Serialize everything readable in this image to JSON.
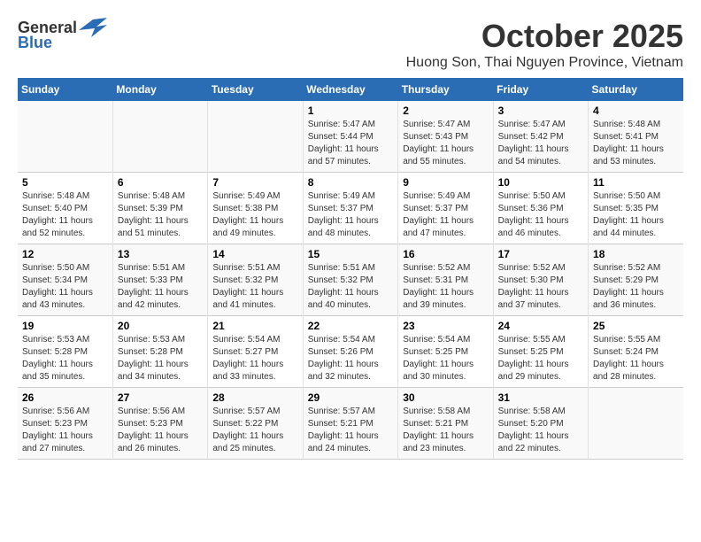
{
  "logo": {
    "general": "General",
    "blue": "Blue"
  },
  "title": {
    "month_year": "October 2025",
    "location": "Huong Son, Thai Nguyen Province, Vietnam"
  },
  "weekdays": [
    "Sunday",
    "Monday",
    "Tuesday",
    "Wednesday",
    "Thursday",
    "Friday",
    "Saturday"
  ],
  "weeks": [
    [
      {
        "day": "",
        "info": ""
      },
      {
        "day": "",
        "info": ""
      },
      {
        "day": "",
        "info": ""
      },
      {
        "day": "1",
        "info": "Sunrise: 5:47 AM\nSunset: 5:44 PM\nDaylight: 11 hours and 57 minutes."
      },
      {
        "day": "2",
        "info": "Sunrise: 5:47 AM\nSunset: 5:43 PM\nDaylight: 11 hours and 55 minutes."
      },
      {
        "day": "3",
        "info": "Sunrise: 5:47 AM\nSunset: 5:42 PM\nDaylight: 11 hours and 54 minutes."
      },
      {
        "day": "4",
        "info": "Sunrise: 5:48 AM\nSunset: 5:41 PM\nDaylight: 11 hours and 53 minutes."
      }
    ],
    [
      {
        "day": "5",
        "info": "Sunrise: 5:48 AM\nSunset: 5:40 PM\nDaylight: 11 hours and 52 minutes."
      },
      {
        "day": "6",
        "info": "Sunrise: 5:48 AM\nSunset: 5:39 PM\nDaylight: 11 hours and 51 minutes."
      },
      {
        "day": "7",
        "info": "Sunrise: 5:49 AM\nSunset: 5:38 PM\nDaylight: 11 hours and 49 minutes."
      },
      {
        "day": "8",
        "info": "Sunrise: 5:49 AM\nSunset: 5:37 PM\nDaylight: 11 hours and 48 minutes."
      },
      {
        "day": "9",
        "info": "Sunrise: 5:49 AM\nSunset: 5:37 PM\nDaylight: 11 hours and 47 minutes."
      },
      {
        "day": "10",
        "info": "Sunrise: 5:50 AM\nSunset: 5:36 PM\nDaylight: 11 hours and 46 minutes."
      },
      {
        "day": "11",
        "info": "Sunrise: 5:50 AM\nSunset: 5:35 PM\nDaylight: 11 hours and 44 minutes."
      }
    ],
    [
      {
        "day": "12",
        "info": "Sunrise: 5:50 AM\nSunset: 5:34 PM\nDaylight: 11 hours and 43 minutes."
      },
      {
        "day": "13",
        "info": "Sunrise: 5:51 AM\nSunset: 5:33 PM\nDaylight: 11 hours and 42 minutes."
      },
      {
        "day": "14",
        "info": "Sunrise: 5:51 AM\nSunset: 5:32 PM\nDaylight: 11 hours and 41 minutes."
      },
      {
        "day": "15",
        "info": "Sunrise: 5:51 AM\nSunset: 5:32 PM\nDaylight: 11 hours and 40 minutes."
      },
      {
        "day": "16",
        "info": "Sunrise: 5:52 AM\nSunset: 5:31 PM\nDaylight: 11 hours and 39 minutes."
      },
      {
        "day": "17",
        "info": "Sunrise: 5:52 AM\nSunset: 5:30 PM\nDaylight: 11 hours and 37 minutes."
      },
      {
        "day": "18",
        "info": "Sunrise: 5:52 AM\nSunset: 5:29 PM\nDaylight: 11 hours and 36 minutes."
      }
    ],
    [
      {
        "day": "19",
        "info": "Sunrise: 5:53 AM\nSunset: 5:28 PM\nDaylight: 11 hours and 35 minutes."
      },
      {
        "day": "20",
        "info": "Sunrise: 5:53 AM\nSunset: 5:28 PM\nDaylight: 11 hours and 34 minutes."
      },
      {
        "day": "21",
        "info": "Sunrise: 5:54 AM\nSunset: 5:27 PM\nDaylight: 11 hours and 33 minutes."
      },
      {
        "day": "22",
        "info": "Sunrise: 5:54 AM\nSunset: 5:26 PM\nDaylight: 11 hours and 32 minutes."
      },
      {
        "day": "23",
        "info": "Sunrise: 5:54 AM\nSunset: 5:25 PM\nDaylight: 11 hours and 30 minutes."
      },
      {
        "day": "24",
        "info": "Sunrise: 5:55 AM\nSunset: 5:25 PM\nDaylight: 11 hours and 29 minutes."
      },
      {
        "day": "25",
        "info": "Sunrise: 5:55 AM\nSunset: 5:24 PM\nDaylight: 11 hours and 28 minutes."
      }
    ],
    [
      {
        "day": "26",
        "info": "Sunrise: 5:56 AM\nSunset: 5:23 PM\nDaylight: 11 hours and 27 minutes."
      },
      {
        "day": "27",
        "info": "Sunrise: 5:56 AM\nSunset: 5:23 PM\nDaylight: 11 hours and 26 minutes."
      },
      {
        "day": "28",
        "info": "Sunrise: 5:57 AM\nSunset: 5:22 PM\nDaylight: 11 hours and 25 minutes."
      },
      {
        "day": "29",
        "info": "Sunrise: 5:57 AM\nSunset: 5:21 PM\nDaylight: 11 hours and 24 minutes."
      },
      {
        "day": "30",
        "info": "Sunrise: 5:58 AM\nSunset: 5:21 PM\nDaylight: 11 hours and 23 minutes."
      },
      {
        "day": "31",
        "info": "Sunrise: 5:58 AM\nSunset: 5:20 PM\nDaylight: 11 hours and 22 minutes."
      },
      {
        "day": "",
        "info": ""
      }
    ]
  ]
}
